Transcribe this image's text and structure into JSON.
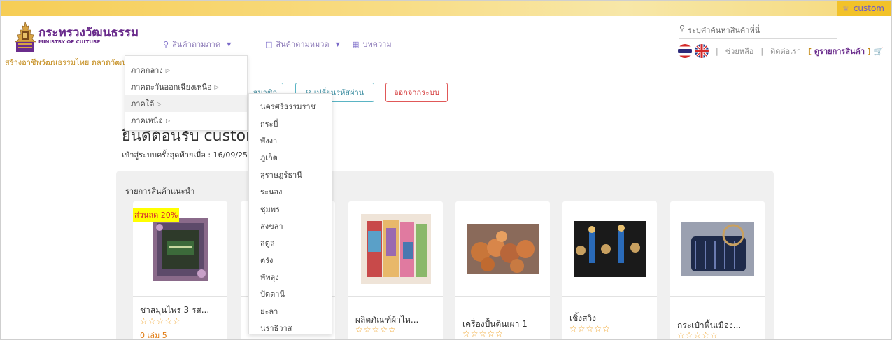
{
  "topbar": {
    "user_icon": "user-icon",
    "username": "custom"
  },
  "header": {
    "logo_title": "กระทรวงวัฒนธรรม",
    "logo_subtitle": "MINISTRY OF CULTURE",
    "tagline": "สร้างอาชีพวัฒนธรรมไทย ตลาดวัฒนธรรม"
  },
  "nav": {
    "by_region": {
      "label": "สินค้าตามภาค",
      "icon": "location-pin-icon"
    },
    "by_category": {
      "label": "สินค้าตามหมวด",
      "icon": "tag-icon"
    },
    "articles": {
      "label": "บทความ",
      "icon": "article-icon"
    }
  },
  "search": {
    "placeholder": "ระบุคำค้นหาสินค้าที่นี่",
    "icon": "search-icon"
  },
  "toplinks": {
    "help": "ช่วยหลือ",
    "contact": "ติดต่อเรา",
    "cart_open": "[",
    "cart": "ดูรายการสินค้า",
    "cart_close": "]",
    "cart_icon": "cart-icon"
  },
  "flags": [
    "thai-flag-icon",
    "uk-flag-icon"
  ],
  "account": {
    "history_fragment": "สมาชิก",
    "change_password": "เปลี่ยนรหัสผ่าน",
    "change_password_icon": "key-icon",
    "logout": "ออกจากระบบ",
    "welcome": "ยินดีต้อนรับ custom",
    "last_login": "เข้าสู่ระบบครั้งสุดท้ายเมื่อ : 16/09/2565"
  },
  "recommended": {
    "title": "รายการสินค้าแนะนำ",
    "discount_badge": "ส่วนลด 20%",
    "products": [
      {
        "name": "ชาสมุนไพร 3 รส...",
        "stars": "☆☆☆☆☆",
        "sold": "0 เล่ม 5"
      },
      {
        "name": "",
        "stars": "",
        "sold": ""
      },
      {
        "name": "ผลิตภัณฑ์ผ้าไห...",
        "stars": "☆☆☆☆☆",
        "sold": ""
      },
      {
        "name": "เครื่องปั้นดินเผา 1",
        "stars": "☆☆☆☆☆",
        "sold": ""
      },
      {
        "name": "เชิ้งสวิง",
        "stars": "☆☆☆☆☆",
        "sold": ""
      },
      {
        "name": "กระเป๋าพื้นเมือง...",
        "stars": "☆☆☆☆☆",
        "sold": ""
      }
    ]
  },
  "region_menu": {
    "items": [
      {
        "label": "ภาคกลาง"
      },
      {
        "label": "ภาคตะวันออกเฉียงเหนือ"
      },
      {
        "label": "ภาคใต้"
      },
      {
        "label": "ภาคเหนือ"
      }
    ],
    "active_item": "ภาคใต้",
    "south_provinces": [
      "นครศรีธรรมราช",
      "กระบี่",
      "พังงา",
      "ภูเก็ต",
      "สุราษฎร์ธานี",
      "ระนอง",
      "ชุมพร",
      "สงขลา",
      "สตูล",
      "ตรัง",
      "พัทลุง",
      "ปัตตานี",
      "ยะลา",
      "นราธิวาส"
    ]
  },
  "colors": {
    "brand_purple": "#6a2c8c",
    "gold": "#f2c229",
    "accent_teal": "#5ab4c4",
    "danger": "#e05858"
  }
}
